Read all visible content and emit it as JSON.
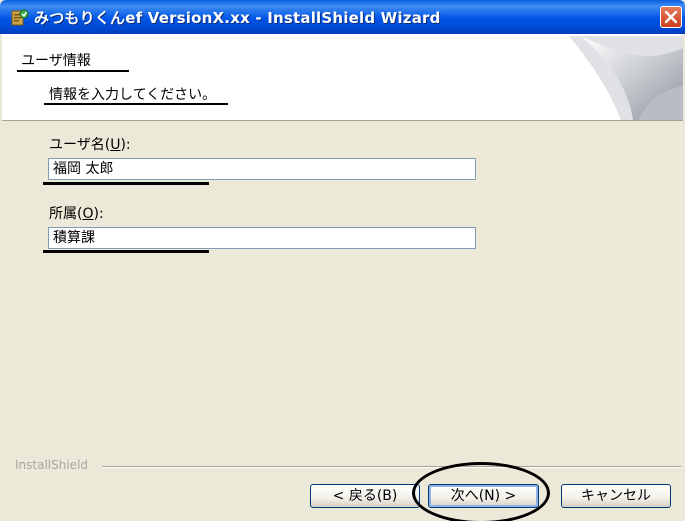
{
  "titlebar": {
    "title": "みつもりくんef VersionX.xx - InstallShield Wizard",
    "app_icon": "installer-icon",
    "close_icon": "close-icon"
  },
  "header": {
    "title": "ユーザ情報",
    "subtitle": "情報を入力してください。"
  },
  "form": {
    "user_name_label": "ユーザ名(",
    "user_name_mnemonic": "U",
    "user_name_label_end": "):",
    "user_name_value": "福岡 太郎",
    "org_label": "所属(",
    "org_mnemonic": "O",
    "org_label_end": "):",
    "org_value": "積算課"
  },
  "footer": {
    "brand": "InstallShield",
    "back_label": "< 戻る(B)",
    "next_label": "次へ(N) >",
    "cancel_label": "キャンセル"
  },
  "colors": {
    "titlebar": "#0055e5",
    "close": "#cc3f1c",
    "dialog_bg": "#ece9d8"
  }
}
